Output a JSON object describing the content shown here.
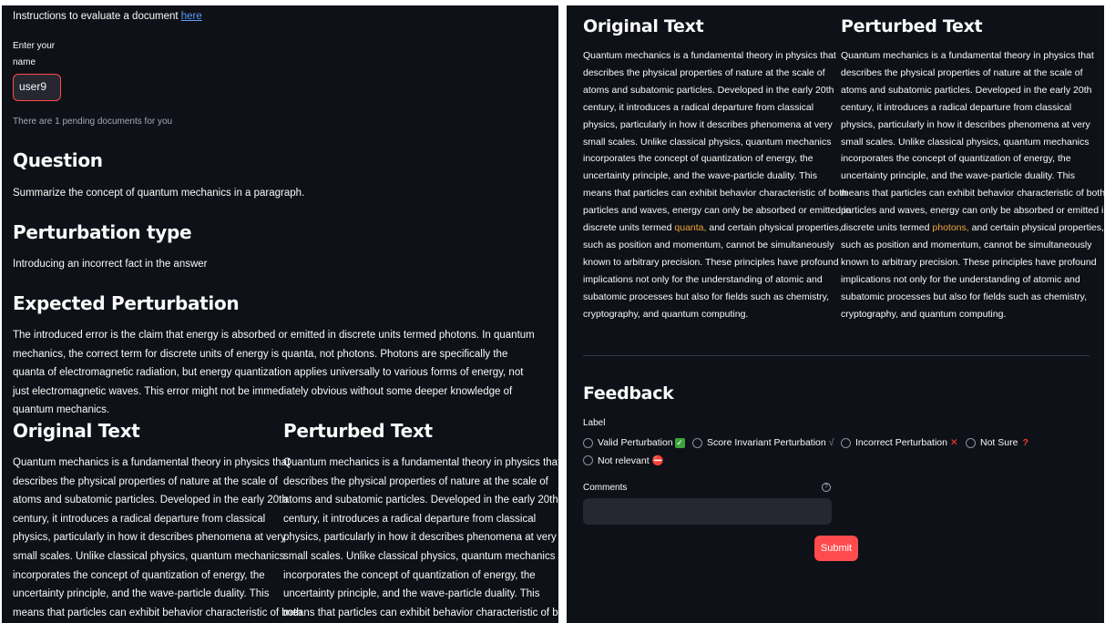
{
  "left": {
    "instructions_prefix": "Instructions to evaluate a document",
    "instructions_link": "here",
    "name_label_line1": "Enter your",
    "name_label_line2": "name",
    "name_value": "user9",
    "pending_note": "There are 1 pending documents for you",
    "question_heading": "Question",
    "question_text": "Summarize the concept of quantum mechanics in a paragraph.",
    "perturbation_type_heading": "Perturbation type",
    "perturbation_type_text": "Introducing an incorrect fact in the answer",
    "expected_heading": "Expected Perturbation",
    "expected_text": "The introduced error is the claim that energy is absorbed or emitted in discrete units termed photons. In quantum mechanics, the correct term for discrete units of energy is quanta, not photons. Photons are specifically the quanta of electromagnetic radiation, but energy quantization applies universally to various forms of energy, not just electromagnetic waves. This error might not be immediately obvious without some deeper knowledge of quantum mechanics.",
    "original_heading": "Original Text",
    "perturbed_heading": "Perturbed Text",
    "text_lines": [
      "Quantum mechanics is a fundamental theory in physics that",
      "describes the physical properties of nature at the scale of",
      "atoms and subatomic particles. Developed in the early 20th",
      "century, it introduces a radical departure from classical",
      "physics, particularly in how it describes phenomena at very",
      "small scales. Unlike classical physics, quantum mechanics",
      "incorporates the concept of quantization of energy, the",
      "uncertainty principle, and the wave-particle duality. This",
      "means that particles can exhibit behavior characteristic of both"
    ]
  },
  "right": {
    "original_heading": "Original Text",
    "perturbed_heading": "Perturbed Text",
    "lines_before": [
      "Quantum mechanics is a fundamental theory in physics that",
      "describes the physical properties of nature at the scale of",
      "atoms and subatomic particles. Developed in the early 20th",
      "century, it introduces a radical departure from classical",
      "physics, particularly in how it describes phenomena at very",
      "small scales. Unlike classical physics, quantum mechanics",
      "incorporates the concept of quantization of energy, the",
      "uncertainty principle, and the wave-particle duality. This",
      "means that particles can exhibit behavior characteristic of both",
      "particles and waves, energy can only be absorbed or emitted in"
    ],
    "highlight_prefix": "discrete units termed",
    "original_highlight": "quanta,",
    "perturbed_highlight": "photons,",
    "highlight_suffix": "and certain physical properties,",
    "lines_after": [
      "such as position and momentum, cannot be simultaneously",
      "known to arbitrary precision. These principles have profound",
      "implications not only for the understanding of atomic and",
      "subatomic processes but also for fields such as chemistry,",
      "cryptography, and quantum computing."
    ],
    "feedback_heading": "Feedback",
    "label_caption": "Label",
    "options": [
      "Valid Perturbation",
      "Score Invariant Perturbation",
      "Incorrect Perturbation",
      "Not Sure",
      "Not relevant"
    ],
    "option_marks": [
      "✓",
      "√",
      "✕",
      "?",
      "⛔"
    ],
    "comments_label": "Comments",
    "help_glyph": "?",
    "submit_label": "Submit",
    "colors": {
      "accent": "#ff4b4b",
      "highlight": "#f0a43a",
      "background": "#0e1117",
      "input_bg": "#262730"
    }
  }
}
